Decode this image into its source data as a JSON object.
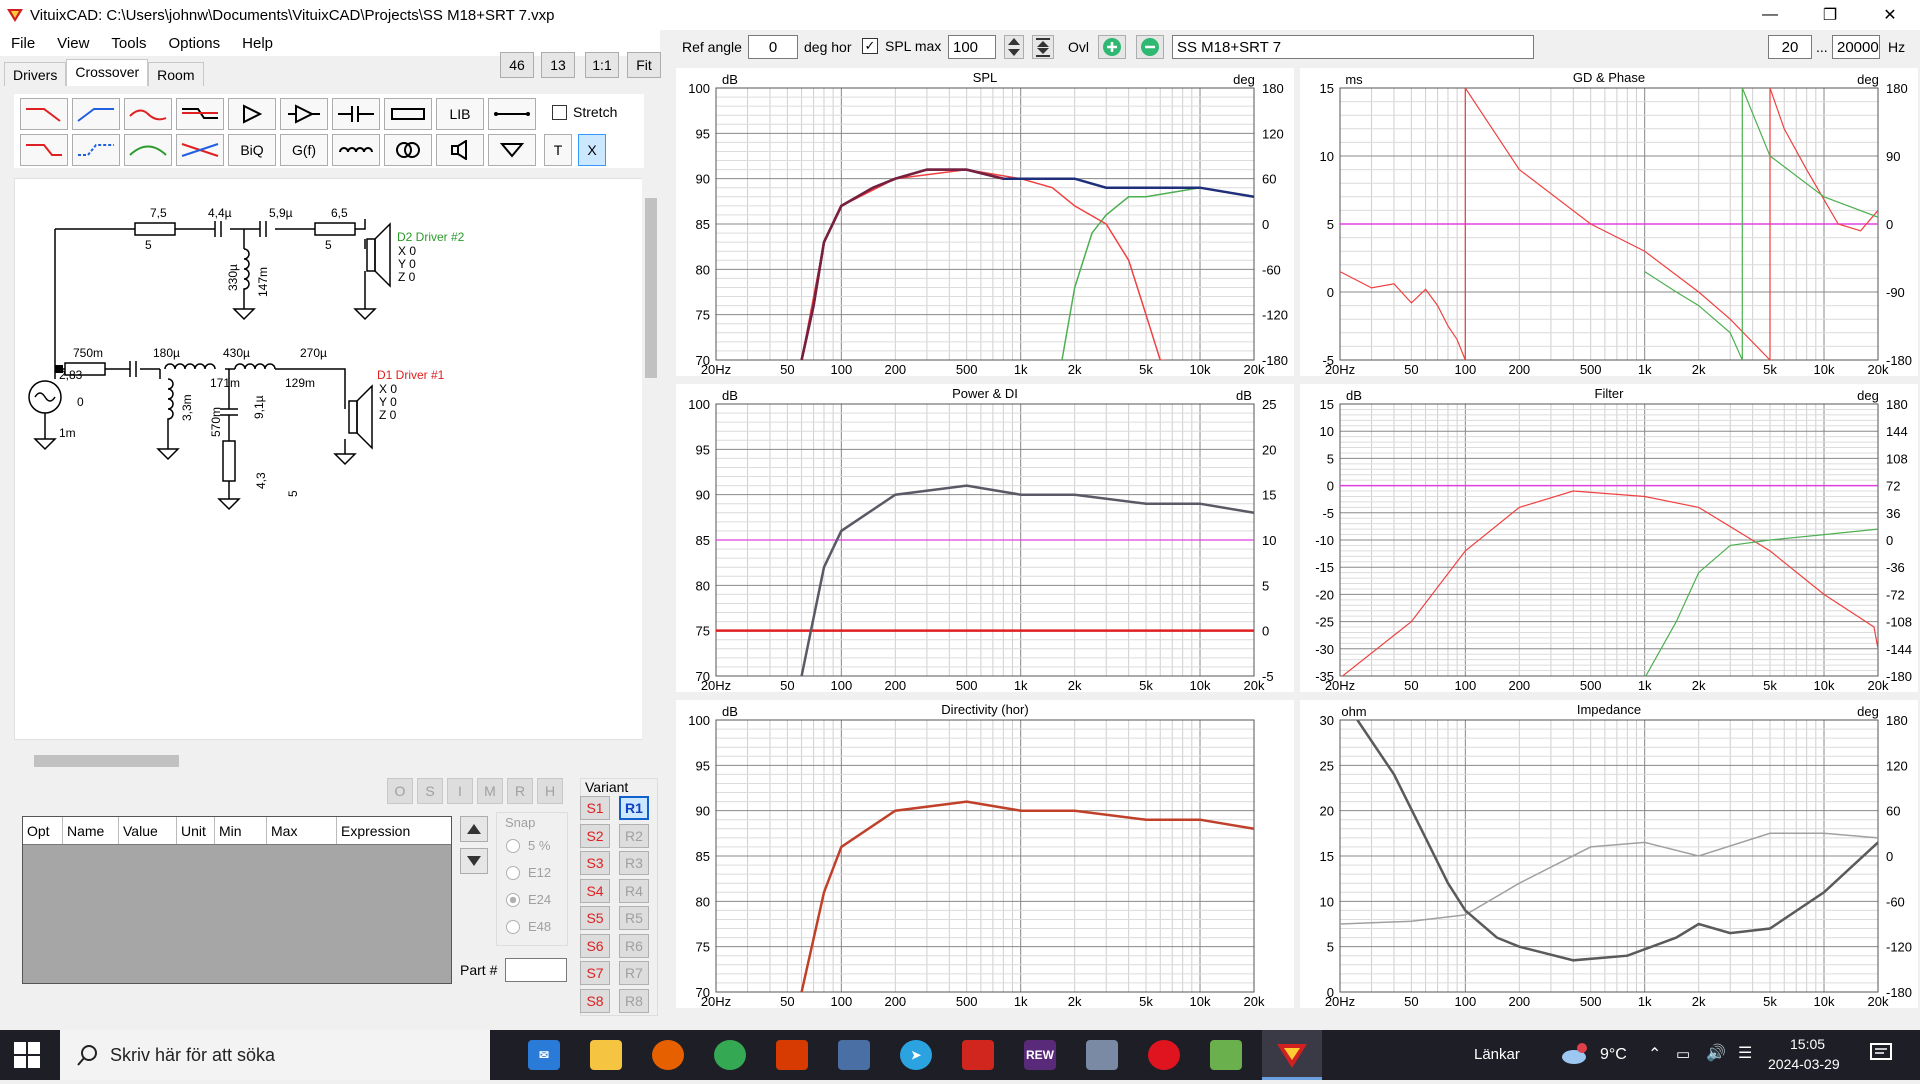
{
  "window": {
    "title": "VituixCAD: C:\\Users\\johnw\\Documents\\VituixCAD\\Projects\\SS M18+SRT 7.vxp"
  },
  "menu": [
    "File",
    "View",
    "Tools",
    "Options",
    "Help"
  ],
  "tabs": [
    "Drivers",
    "Crossover",
    "Room"
  ],
  "topbuttons": {
    "b1": "46",
    "b2": "13",
    "b3": "1:1",
    "b4": "Fit"
  },
  "toolbar": {
    "lib": "LIB",
    "biq": "BiQ",
    "gf": "G(f)",
    "t": "T",
    "x": "X",
    "stretch": "Stretch"
  },
  "schematic": {
    "r1": "7,5",
    "r1b": "5",
    "c1": "4,4µ",
    "c2": "5,9µ",
    "r2": "6,5",
    "r2b": "5",
    "l1": "330µ",
    "l1b": "147m",
    "driver2": "D2 Driver #2",
    "d2x": "X 0",
    "d2y": "Y 0",
    "d2z": "Z 0",
    "r3": "750m",
    "c3": "180µ",
    "l2": "430µ",
    "l2b": "171m",
    "l3": "270µ",
    "l3b": "129m",
    "l4": "3,3m",
    "l4b": "570m",
    "c4": "9,1µ",
    "r4": "4,3",
    "r4b": "5",
    "src1": "2,83",
    "src2": "0",
    "src3": "1m",
    "driver1": "D1 Driver #1",
    "d1x": "X 0",
    "d1y": "Y 0",
    "d1z": "Z 0"
  },
  "opt_buttons": [
    "O",
    "S",
    "I",
    "M",
    "R",
    "H"
  ],
  "variant_label": "Variant",
  "variants_s": [
    "S1",
    "S2",
    "S3",
    "S4",
    "S5",
    "S6",
    "S7",
    "S8"
  ],
  "variants_r": [
    "R1",
    "R2",
    "R3",
    "R4",
    "R5",
    "R6",
    "R7",
    "R8"
  ],
  "table_headers": [
    "Opt",
    "Name",
    "Value",
    "Unit",
    "Min",
    "Max",
    "Expression"
  ],
  "snap": {
    "label": "Snap",
    "options": [
      "5 %",
      "E12",
      "E24",
      "E48"
    ],
    "selected": "E24"
  },
  "part_label": "Part #",
  "toprow": {
    "ref_angle_label": "Ref angle",
    "ref_angle": "0",
    "deg_hor": "deg hor",
    "spl_max_label": "SPL max",
    "spl_max": "100",
    "ovl": "Ovl",
    "project": "SS M18+SRT 7",
    "f_low": "20",
    "f_sep": "...",
    "f_high": "20000",
    "hz": "Hz"
  },
  "freq_ticks": [
    "20Hz",
    "50",
    "100",
    "200",
    "500",
    "1k",
    "2k",
    "5k",
    "10k",
    "20k"
  ],
  "colors": {
    "darkred": "#7a1f3c",
    "navy": "#1f2f7a",
    "green": "#4caf50",
    "red": "#f04040",
    "magenta": "#e040e0",
    "gray": "#5a5a66",
    "brick": "#c0402a",
    "redline": "#e02020"
  },
  "charts": {
    "spl": {
      "title": "SPL",
      "ylabel": "dB",
      "y2label": "deg",
      "yticks": [
        "100",
        "95",
        "90",
        "85",
        "80",
        "75",
        "70"
      ],
      "y2ticks": [
        "180",
        "120",
        "60",
        "0",
        "-60",
        "-120",
        "-180"
      ]
    },
    "gd": {
      "title": "GD & Phase",
      "ylabel": "ms",
      "y2label": "deg",
      "yticks": [
        "15",
        "10",
        "5",
        "0",
        "-5"
      ],
      "y2ticks": [
        "180",
        "90",
        "0",
        "-90",
        "-180"
      ]
    },
    "power": {
      "title": "Power & DI",
      "ylabel": "dB",
      "y2label": "dB",
      "yticks": [
        "100",
        "95",
        "90",
        "85",
        "80",
        "75",
        "70"
      ],
      "y2ticks": [
        "25",
        "20",
        "15",
        "10",
        "5",
        "0",
        "-5"
      ]
    },
    "filter": {
      "title": "Filter",
      "ylabel": "dB",
      "y2label": "deg",
      "yticks": [
        "15",
        "10",
        "5",
        "0",
        "-5",
        "-10",
        "-15",
        "-20",
        "-25",
        "-30",
        "-35"
      ],
      "y2ticks": [
        "180",
        "144",
        "108",
        "72",
        "36",
        "0",
        "-36",
        "-72",
        "-108",
        "-144",
        "-180"
      ]
    },
    "dir": {
      "title": "Directivity (hor)",
      "ylabel": "dB",
      "yticks": [
        "100",
        "95",
        "90",
        "85",
        "80",
        "75",
        "70"
      ]
    },
    "imp": {
      "title": "Impedance",
      "ylabel": "ohm",
      "y2label": "deg",
      "yticks": [
        "30",
        "25",
        "20",
        "15",
        "10",
        "5",
        "0"
      ],
      "y2ticks": [
        "180",
        "120",
        "60",
        "0",
        "-60",
        "-120",
        "-180"
      ]
    }
  },
  "chart_data": [
    {
      "type": "line",
      "title": "SPL",
      "xlabel": "",
      "ylabel": "dB",
      "xscale": "log",
      "xlim": [
        20,
        20000
      ],
      "ylim": [
        70,
        100
      ],
      "series": [
        {
          "values_x": [
            60,
            70,
            80,
            100,
            150,
            200,
            300,
            500,
            800,
            1000,
            1500,
            2000,
            3000,
            5000,
            10000,
            20000
          ],
          "values_y": [
            70,
            76,
            83,
            87,
            89,
            90,
            91,
            91,
            90,
            90,
            90,
            90,
            89,
            89,
            89,
            88
          ]
        },
        {
          "values_x": [
            60,
            80,
            100,
            200,
            500,
            1000,
            1500,
            2000,
            3000,
            4000,
            5000,
            6000,
            8000
          ],
          "values_y": [
            70,
            83,
            87,
            90,
            91,
            90,
            89,
            87,
            85,
            81,
            75,
            70,
            65
          ]
        },
        {
          "values_x": [
            1700,
            2000,
            2500,
            3000,
            4000,
            5000,
            10000,
            20000
          ],
          "values_y": [
            70,
            78,
            84,
            86,
            88,
            88,
            89,
            88
          ]
        }
      ]
    },
    {
      "type": "line",
      "title": "GD & Phase",
      "ylabel": "ms",
      "xscale": "log",
      "xlim": [
        20,
        20000
      ],
      "ylim": [
        -5,
        15
      ]
    },
    {
      "type": "line",
      "title": "Power & DI",
      "ylabel": "dB",
      "xscale": "log",
      "xlim": [
        20,
        20000
      ],
      "ylim": [
        70,
        100
      ],
      "series": [
        {
          "values_x": [
            60,
            80,
            100,
            200,
            500,
            1000,
            2000,
            5000,
            10000,
            20000
          ],
          "values_y": [
            70,
            82,
            86,
            90,
            91,
            90,
            90,
            89,
            89,
            88
          ]
        }
      ]
    },
    {
      "type": "line",
      "title": "Filter",
      "ylabel": "dB",
      "xscale": "log",
      "xlim": [
        20,
        20000
      ],
      "ylim": [
        -35,
        15
      ]
    },
    {
      "type": "line",
      "title": "Directivity (hor)",
      "ylabel": "dB",
      "xscale": "log",
      "xlim": [
        20,
        20000
      ],
      "ylim": [
        70,
        100
      ],
      "series": [
        {
          "values_x": [
            60,
            80,
            100,
            200,
            500,
            1000,
            2000,
            5000,
            10000,
            20000
          ],
          "values_y": [
            70,
            81,
            86,
            90,
            91,
            90,
            90,
            89,
            89,
            88
          ]
        }
      ]
    },
    {
      "type": "line",
      "title": "Impedance",
      "ylabel": "ohm",
      "xscale": "log",
      "xlim": [
        20,
        20000
      ],
      "ylim": [
        0,
        30
      ]
    }
  ],
  "taskbar": {
    "search": "Skriv här för att söka",
    "links": "Länkar",
    "temp": "9°C",
    "time": "15:05",
    "date": "2024-03-29",
    "rew": "REW"
  }
}
